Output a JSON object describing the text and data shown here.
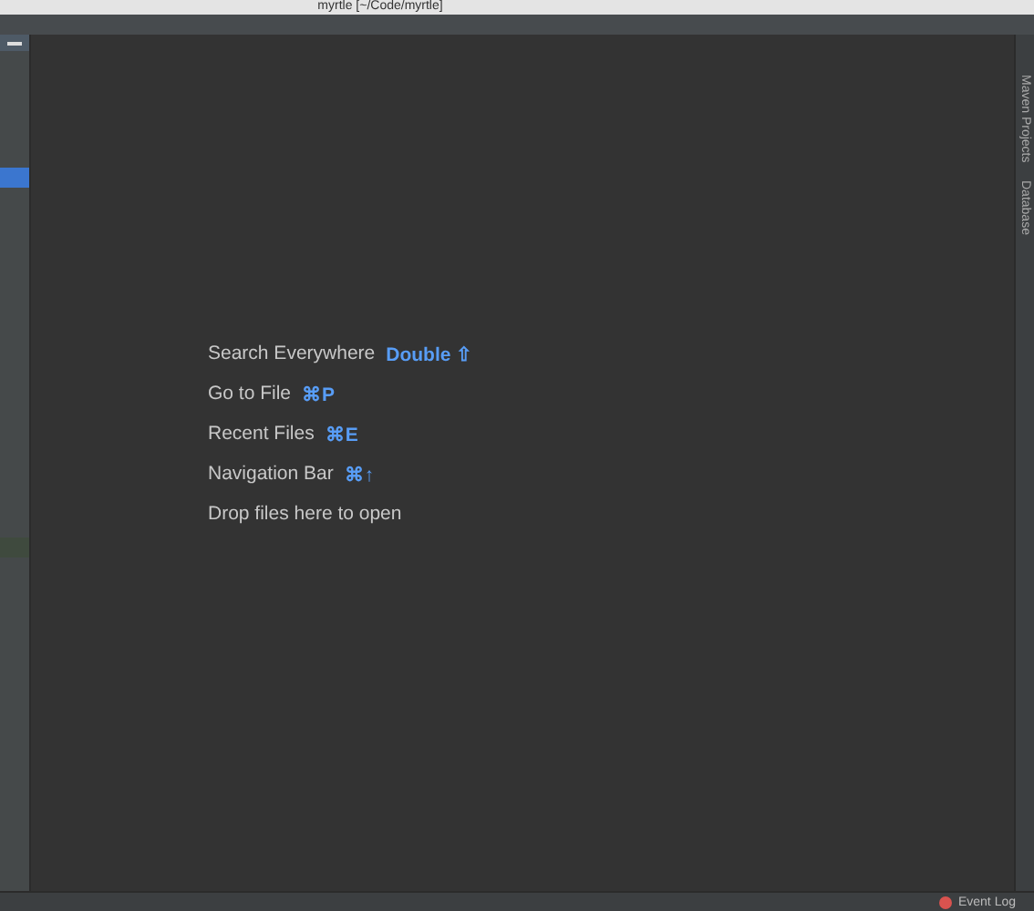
{
  "window": {
    "title": "myrtle [~/Code/myrtle]"
  },
  "project_panel": {
    "rows": [
      {
        "selected": true
      },
      {
        "selected": false
      }
    ]
  },
  "editor_hints": [
    {
      "label": "Search Everywhere",
      "shortcut": "Double ⇧"
    },
    {
      "label": "Go to File",
      "shortcut": "⌘P"
    },
    {
      "label": "Recent Files",
      "shortcut": "⌘E"
    },
    {
      "label": "Navigation Bar",
      "shortcut": "⌘↑"
    },
    {
      "label": "Drop files here to open"
    }
  ],
  "right_tool_windows": [
    "Maven Projects",
    "Database"
  ],
  "status_bar": {
    "event_log": "Event Log"
  }
}
